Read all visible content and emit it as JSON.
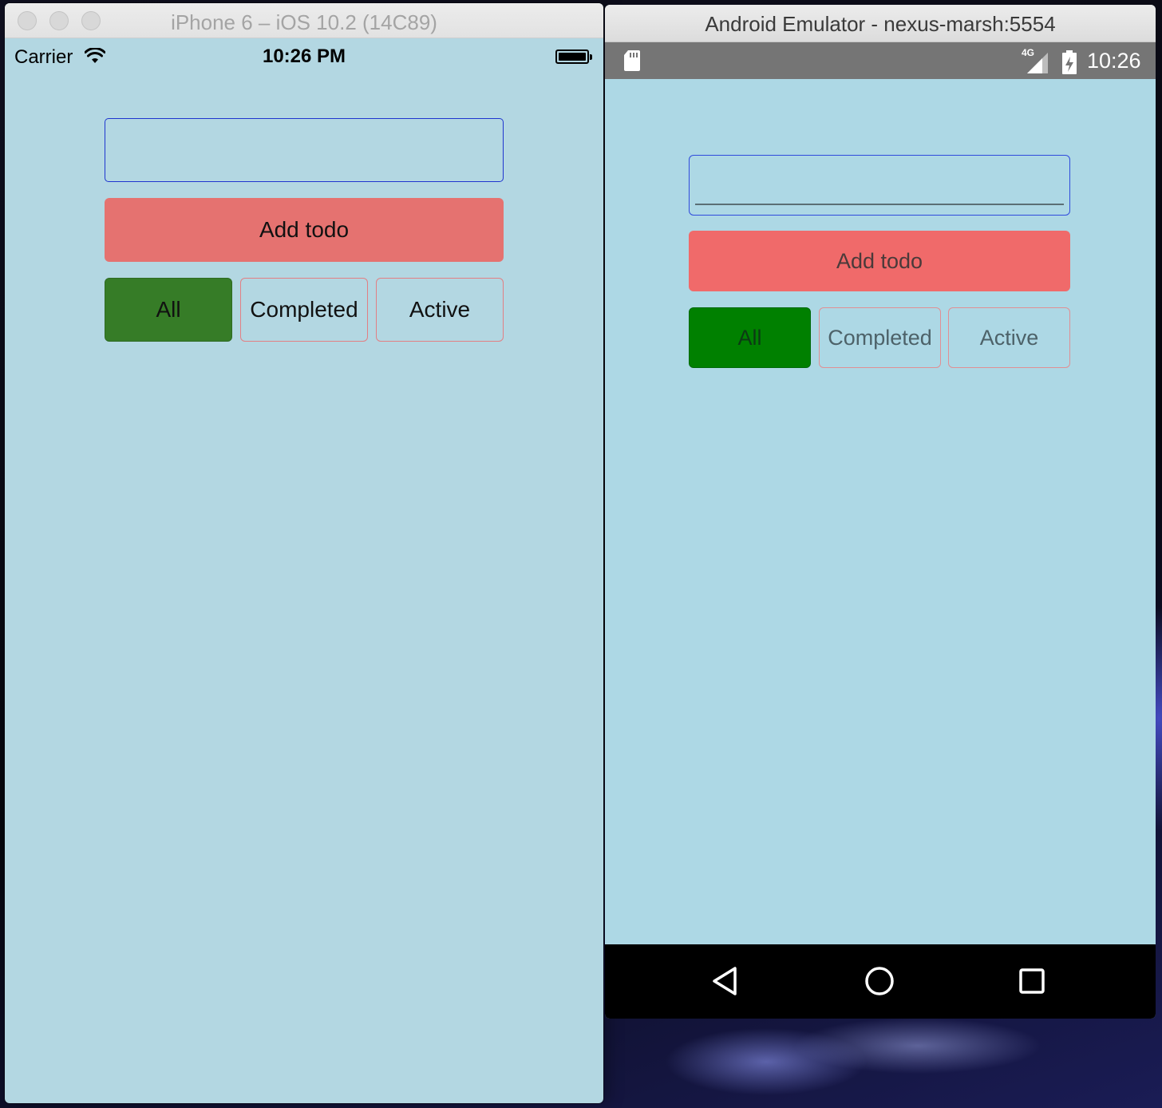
{
  "ios": {
    "window_title": "iPhone 6 – iOS 10.2 (14C89)",
    "status": {
      "carrier": "Carrier",
      "time": "10:26 PM"
    },
    "input": {
      "value": "",
      "placeholder": ""
    },
    "add_button": "Add todo",
    "filters": [
      {
        "label": "All",
        "selected": true
      },
      {
        "label": "Completed",
        "selected": false
      },
      {
        "label": "Active",
        "selected": false
      }
    ],
    "colors": {
      "background": "#b3d7e2",
      "add_button": "#e57270",
      "selected_filter": "#367c27",
      "input_border": "#1f35cf"
    }
  },
  "android": {
    "window_title": "Android Emulator - nexus-marsh:5554",
    "status": {
      "network": "4G",
      "time": "10:26"
    },
    "input": {
      "value": "",
      "placeholder": ""
    },
    "add_button": "Add todo",
    "filters": [
      {
        "label": "All",
        "selected": true
      },
      {
        "label": "Completed",
        "selected": false
      },
      {
        "label": "Active",
        "selected": false
      }
    ],
    "nav_icons": [
      "back-icon",
      "home-icon",
      "recents-icon"
    ],
    "colors": {
      "background": "#add8e5",
      "add_button": "#f06a6a",
      "selected_filter": "#008000",
      "input_border": "#2f4bdc"
    }
  }
}
